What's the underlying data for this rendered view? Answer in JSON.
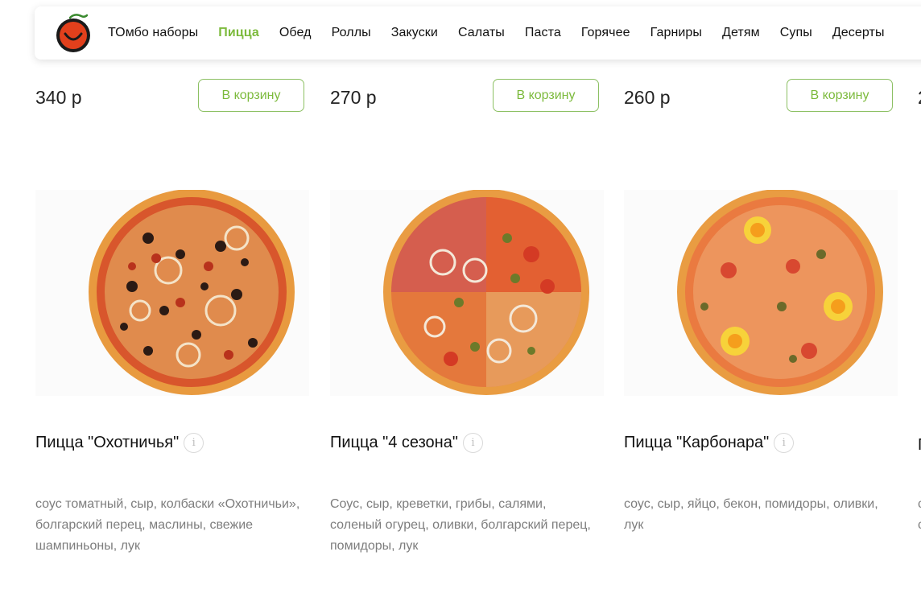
{
  "nav": {
    "logo": "tombo-logo",
    "items": [
      {
        "label": "ТОмбо наборы",
        "active": false
      },
      {
        "label": "Пицца",
        "active": true
      },
      {
        "label": "Обед",
        "active": false
      },
      {
        "label": "Роллы",
        "active": false
      },
      {
        "label": "Закуски",
        "active": false
      },
      {
        "label": "Салаты",
        "active": false
      },
      {
        "label": "Паста",
        "active": false
      },
      {
        "label": "Горячее",
        "active": false
      },
      {
        "label": "Гарниры",
        "active": false
      },
      {
        "label": "Детям",
        "active": false
      },
      {
        "label": "Супы",
        "active": false
      },
      {
        "label": "Десерты",
        "active": false
      }
    ]
  },
  "colors": {
    "accent": "#7cba3c",
    "button_border": "#8cc063",
    "description": "#7d7d7d"
  },
  "products": [
    {
      "price": "340 р",
      "cart_label": "В корзину",
      "name": "Пицца \"Охотничья\"",
      "info_icon": "info-icon",
      "description": "соус томатный, сыр, колбаски «Охотничьи», болгарский перец, маслины, свежие шампиньоны, лук",
      "image": "pizza-hunter"
    },
    {
      "price": "270 р",
      "cart_label": "В корзину",
      "name": "Пицца \"4 сезона\"",
      "info_icon": "info-icon",
      "description": "Соус, сыр, креветки, грибы, салями, соленый огурец, оливки, болгарский перец, помидоры, лук",
      "image": "pizza-four-seasons"
    },
    {
      "price": "260 р",
      "cart_label": "В корзину",
      "name": "Пицца \"Карбонара\"",
      "info_icon": "info-icon",
      "description": "соус, сыр, яйцо, бекон, помидоры, оливки, лук",
      "image": "pizza-carbonara"
    }
  ],
  "partial_product": {
    "price": "2",
    "name": "П",
    "description": "с с"
  }
}
